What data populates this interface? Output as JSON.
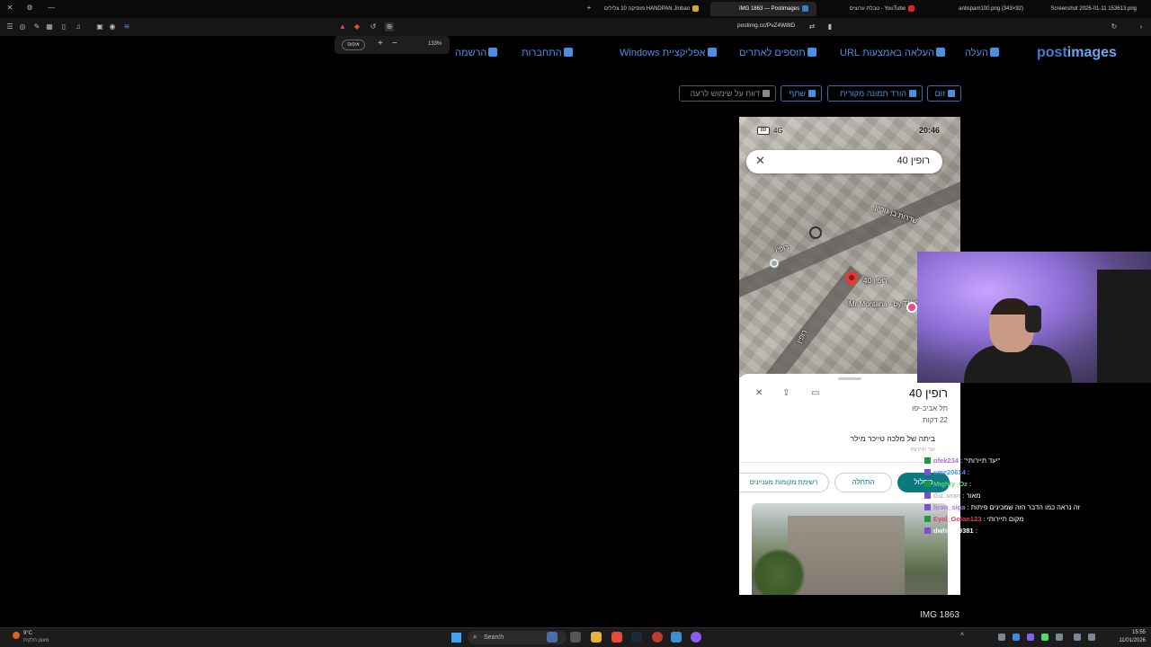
{
  "browser": {
    "tabs": [
      {
        "label": "Screenshot 2026-01-11 153613.png",
        "active": false
      },
      {
        "label": "antispam100.png (343×92)",
        "active": false
      },
      {
        "label": "YouTube - טבלת ערוצים",
        "active": false
      },
      {
        "label": "IMG 1863 — Postimages",
        "active": true
      },
      {
        "label": "HANDPAN Jinbao מוסיקה 10 צלילים",
        "active": false
      }
    ],
    "url": "postimg.cc/PvZ4W8tD"
  },
  "zoom_popup": {
    "reset_label": "איפוס",
    "level": "133%",
    "plus": "+",
    "minus": "−"
  },
  "site": {
    "logo_main": "post",
    "logo_accent": "images",
    "nav": {
      "upload": "העלה",
      "upload_url": "העלאה באמצעות URL",
      "addons": "תוספים לאתרים",
      "windows_app": "אפליקציית Windows",
      "login": "התחברות",
      "register": "הרשמה"
    },
    "actions": {
      "zoom": "זום",
      "download": "הורד תמונה מקורית",
      "share": "שתף",
      "report": "דווח על שימוש לרעה"
    },
    "image_caption": "IMG 1863"
  },
  "phone_image": {
    "status_time": "20:46",
    "status_network": "4G",
    "status_battery": "88",
    "search_text": "רופין 40",
    "map_labels": {
      "ben_gurion": "שדרות בן גוריון",
      "ruppin_a": "רופין",
      "ruppin_b": "רופין",
      "pin_label": "רופין 40",
      "poi": "Mr Montana - by TLV2GO"
    },
    "sheet": {
      "title": "רופין 40",
      "city": "תל אביב-יפו",
      "drive_time": "22 דקות",
      "description": "ביתה של מלכה טייכר מילר",
      "sub": "יעד תיירותי",
      "route": "מסלול",
      "start": "התחלה",
      "list": "רשימת מקומות מעניינים"
    }
  },
  "chat": [
    {
      "user": "ofek234",
      "msg": "\"יעד תיירותי\"",
      "color": "#b66ce0",
      "badge": "g"
    },
    {
      "user": "cme20614",
      "msg": "",
      "color": "#4a90e2",
      "badge": "p"
    },
    {
      "user": "Mighty_Oz",
      "msg": "",
      "color": "#5bd46b",
      "badge": "g"
    },
    {
      "user": "Gu..vran",
      "msg": "מאור",
      "color": "#bbbbbb",
      "badge": "p"
    },
    {
      "user": "liron_siga",
      "msg": "זה נראה כמו הדבר הזה שמכינים פיתות",
      "color": "#b66ce0",
      "badge": "p"
    },
    {
      "user": "Eyal_Golan123",
      "msg": "מקום תיירותי",
      "color": "#e0405a",
      "badge": "g"
    },
    {
      "user": "dwhite19381",
      "msg": "",
      "color": "#ffffff",
      "badge": "p"
    }
  ],
  "taskbar": {
    "weather_temp": "9°C",
    "weather_desc": "מעונן חלקית",
    "search_placeholder": "Search",
    "time": "15:55",
    "date": "11/01/2026"
  },
  "colors": {
    "accent": "#4a90e2",
    "route_button": "#0b7a80"
  }
}
